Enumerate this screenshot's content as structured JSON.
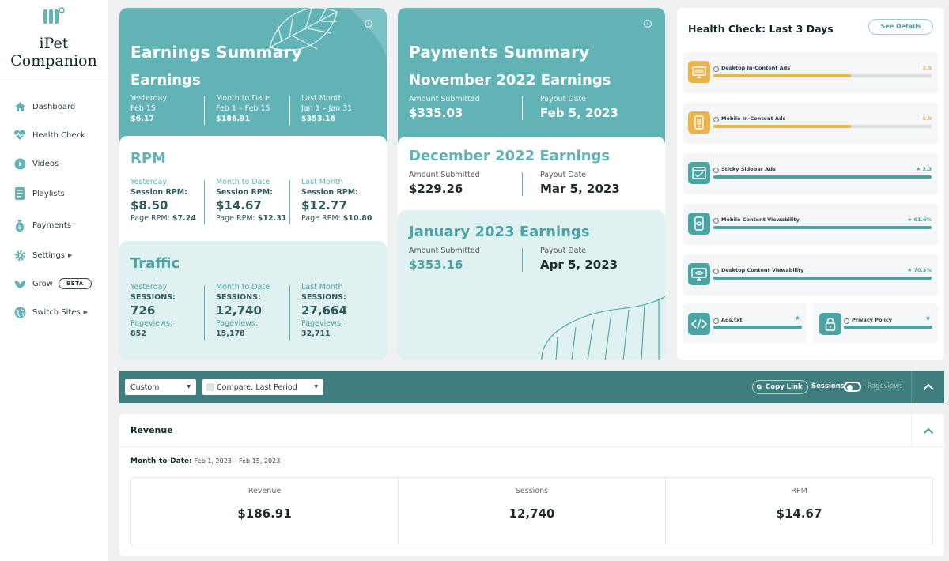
{
  "app": {
    "name": "iPet Companion"
  },
  "sidebar": {
    "items": [
      {
        "label": "Dashboard",
        "icon": "home-icon"
      },
      {
        "label": "Health Check",
        "icon": "heartbeat-icon"
      },
      {
        "label": "Videos",
        "icon": "play-icon"
      },
      {
        "label": "Playlists",
        "icon": "playlist-icon"
      },
      {
        "label": "Payments",
        "icon": "money-bag-icon"
      },
      {
        "label": "Settings",
        "icon": "gear-icon"
      },
      {
        "label": "Grow",
        "icon": "leaf-icon",
        "badge": "BETA"
      },
      {
        "label": "Switch Sites",
        "icon": "globe-icon"
      }
    ]
  },
  "earnings": {
    "title": "Earnings Summary",
    "section": "Earnings",
    "cols": [
      {
        "head": "Yesterday",
        "sub": "Feb 15",
        "val": "$6.17"
      },
      {
        "head": "Month to Date",
        "sub": "Feb 1 – Feb 15",
        "val": "$186.91"
      },
      {
        "head": "Last Month",
        "sub": "Jan 1 – Jan 31",
        "val": "$353.16"
      }
    ]
  },
  "rpm": {
    "title": "RPM",
    "cols": [
      {
        "head": "Yesterday",
        "label": "Session RPM:",
        "val": "$8.50",
        "page_label": "Page RPM:",
        "page_val": "$7.24"
      },
      {
        "head": "Month to Date",
        "label": "Session RPM:",
        "val": "$14.67",
        "page_label": "Page RPM:",
        "page_val": "$12.31"
      },
      {
        "head": "Last Month",
        "label": "Session RPM:",
        "val": "$12.77",
        "page_label": "Page RPM:",
        "page_val": "$10.80"
      }
    ]
  },
  "traffic": {
    "title": "Traffic",
    "cols": [
      {
        "head": "Yesterday",
        "label": "SESSIONS:",
        "val": "726",
        "pv_label": "Pageviews:",
        "pv_val": "852"
      },
      {
        "head": "Month to Date",
        "label": "SESSIONS:",
        "val": "12,740",
        "pv_label": "Pageviews:",
        "pv_val": "15,178"
      },
      {
        "head": "Last Month",
        "label": "SESSIONS:",
        "val": "27,664",
        "pv_label": "Pageviews:",
        "pv_val": "32,711"
      }
    ]
  },
  "payments": {
    "title": "Payments Summary",
    "blocks": [
      {
        "title": "November 2022 Earnings",
        "amount_label": "Amount Submitted",
        "amount": "$335.03",
        "date_label": "Payout Date",
        "date": "Feb 5, 2023"
      },
      {
        "title": "December 2022 Earnings",
        "amount_label": "Amount Submitted",
        "amount": "$229.26",
        "date_label": "Payout Date",
        "date": "Mar 5, 2023"
      },
      {
        "title": "January 2023 Earnings",
        "amount_label": "Amount Submitted",
        "amount": "$353.16",
        "date_label": "Payout Date",
        "date": "Apr 5, 2023"
      }
    ]
  },
  "health": {
    "title": "Health Check: Last 3 Days",
    "details_button": "See Details",
    "rows": [
      {
        "label": "Desktop In-Content Ads",
        "value": "2.5",
        "fill": 0.63,
        "color": "#e9b44c",
        "icon": "desktop-icon"
      },
      {
        "label": "Mobile In-Content Ads",
        "value": "5.0",
        "fill": 0.63,
        "color": "#e9b44c",
        "icon": "mobile-icon"
      },
      {
        "label": "Sticky Sidebar Ads",
        "value": "2.3",
        "fill": 1.0,
        "color": "#4ba3a4",
        "icon": "sidebar-window-icon"
      },
      {
        "label": "Mobile Content Viewability",
        "value": "61.6%",
        "fill": 1.0,
        "color": "#4ba3a4",
        "icon": "mobile-view-icon"
      },
      {
        "label": "Desktop Content Viewability",
        "value": "70.3%",
        "fill": 1.0,
        "color": "#4ba3a4",
        "icon": "desktop-view-icon"
      }
    ],
    "bottom": [
      {
        "label": "Ads.txt",
        "icon": "code-icon"
      },
      {
        "label": "Privacy Policy",
        "icon": "lock-icon"
      }
    ]
  },
  "filters": {
    "range": "Custom",
    "compare": "Compare: Last Period",
    "copy_link": "Copy Link",
    "toggle_left": "Sessions",
    "toggle_right": "Pageviews"
  },
  "revenue": {
    "title": "Revenue",
    "mtd_label": "Month-to-Date:",
    "mtd_range": "Feb 1, 2023 – Feb 15, 2023",
    "cols": [
      {
        "label": "Revenue",
        "value": "$186.91"
      },
      {
        "label": "Sessions",
        "value": "12,740"
      },
      {
        "label": "RPM",
        "value": "$14.67"
      }
    ]
  }
}
